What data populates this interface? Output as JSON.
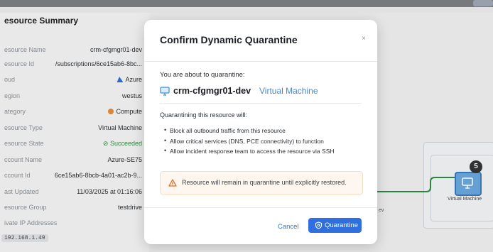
{
  "background": {
    "summary_title": "esource Summary",
    "rows": [
      {
        "key": "esource Name",
        "value": "crm-cfgmgr01-dev"
      },
      {
        "key": "esource Id",
        "value": "/subscriptions/6ce15ab6-8bc..."
      },
      {
        "key": "oud",
        "value": "Azure",
        "icon": "azure-icon"
      },
      {
        "key": "egion",
        "value": "westus"
      },
      {
        "key": "ategory",
        "value": "Compute",
        "icon": "compute-icon"
      },
      {
        "key": "esource Type",
        "value": "Virtual Machine"
      },
      {
        "key": "esource State",
        "value": "Succeeded",
        "icon": "check-circle-icon"
      },
      {
        "key": "ccount Name",
        "value": "Azure-SE75"
      },
      {
        "key": "ccount Id",
        "value": "6ce15ab6-8bcb-4a01-ac2b-9..."
      },
      {
        "key": "ast Updated",
        "value": "11/03/2025 at 01:16:06"
      },
      {
        "key": "esource Group",
        "value": "testdrive"
      },
      {
        "key": "ivate IP Addresses",
        "value": ""
      }
    ],
    "ip_address": "192.168.1.49",
    "canvas": {
      "node_badge": "5",
      "vm_label": "Virtual Machine",
      "dev_label": "ev"
    }
  },
  "modal": {
    "title": "Confirm Dynamic Quarantine",
    "close_label": "×",
    "intro": "You are about to quarantine:",
    "resource_name": "crm-cfgmgr01-dev",
    "resource_type": "Virtual Machine",
    "effects_heading": "Quarantining this resource will:",
    "effects": [
      "Block all outbound traffic from this resource",
      "Allow critical services (DNS, PCE connectivity) to function",
      "Allow incident response team to access the resource via SSH"
    ],
    "warning": "Resource will remain in quarantine until explicitly restored.",
    "cancel_label": "Cancel",
    "confirm_label": "Quarantine"
  },
  "colors": {
    "primary": "#2f6fe0",
    "warning": "#e0702b",
    "success": "#2f8a45",
    "link": "#4a86c5"
  }
}
